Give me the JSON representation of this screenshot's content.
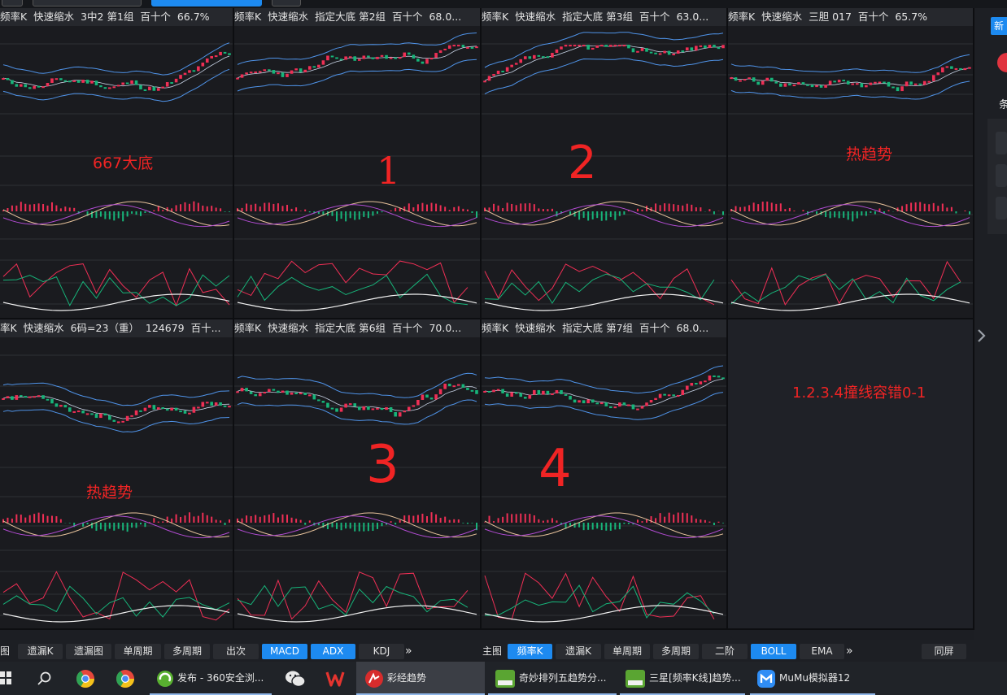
{
  "panels": [
    {
      "id": "p1",
      "title_parts": [
        "频率K",
        "快速缩水",
        "3中2 第1组",
        "百十个",
        "66.7%"
      ]
    },
    {
      "id": "p2",
      "title_parts": [
        "频率K",
        "快速缩水",
        "指定大底 第2组",
        "百十个",
        "68.0..."
      ]
    },
    {
      "id": "p3",
      "title_parts": [
        "频率K",
        "快速缩水",
        "指定大底 第3组",
        "百十个",
        "63.0..."
      ]
    },
    {
      "id": "p4",
      "title_parts": [
        "频率K",
        "快速缩水",
        "三胆 017",
        "百十个",
        "65.7%"
      ]
    },
    {
      "id": "p5",
      "title_parts": [
        "率K",
        "快速缩水",
        "6码=23（重）",
        "124679",
        "百十..."
      ]
    },
    {
      "id": "p6",
      "title_parts": [
        "频率K",
        "快速缩水",
        "指定大底 第6组",
        "百十个",
        "70.0..."
      ]
    },
    {
      "id": "p7",
      "title_parts": [
        "频率K",
        "快速缩水",
        "指定大底 第7组",
        "百十个",
        "68.0..."
      ]
    }
  ],
  "annotations": {
    "a1": "667大底",
    "a2": "1",
    "a3": "2",
    "a4": "热趋势",
    "a5": "热趋势",
    "a6": "3",
    "a7": "4",
    "a8": "1.2.3.4撞线容错0-1"
  },
  "toolbar_left": {
    "partial_label": "图",
    "buttons": [
      {
        "label": "遗漏K",
        "active": false
      },
      {
        "label": "遗漏图",
        "active": false
      },
      {
        "label": "单周期",
        "active": false
      },
      {
        "label": "多周期",
        "active": false
      },
      {
        "label": "出次",
        "active": false
      },
      {
        "label": "MACD",
        "active": true
      },
      {
        "label": "ADX",
        "active": true
      },
      {
        "label": "KDJ",
        "active": false
      }
    ],
    "more": "»"
  },
  "toolbar_right": {
    "label": "主图",
    "buttons": [
      {
        "label": "频率K",
        "active": true
      },
      {
        "label": "遗漏K",
        "active": false
      },
      {
        "label": "单周期",
        "active": false
      },
      {
        "label": "多周期",
        "active": false
      },
      {
        "label": "二阶",
        "active": false
      },
      {
        "label": "BOLL",
        "active": true
      },
      {
        "label": "EMA",
        "active": false
      }
    ],
    "more": "»",
    "tongping": "同屏"
  },
  "sidebar": {
    "glyph1": "新",
    "glyph2": "条"
  },
  "taskbar": {
    "items": [
      {
        "label": "发布 - 360安全浏...",
        "icon": "browser-360-icon"
      },
      {
        "label": "彩经趋势",
        "icon": "caijing-icon"
      },
      {
        "label": "奇妙排列五趋势分...",
        "icon": "app-icon"
      },
      {
        "label": "三星[频率K线]趋势...",
        "icon": "app-icon"
      },
      {
        "label": "MuMu模拟器12",
        "icon": "mumu-icon"
      }
    ]
  },
  "colors": {
    "up": "#ef2f55",
    "down": "#17b57a",
    "boll": "#4f93e8",
    "accent": "#1d8af0",
    "annotation": "#f02424"
  }
}
